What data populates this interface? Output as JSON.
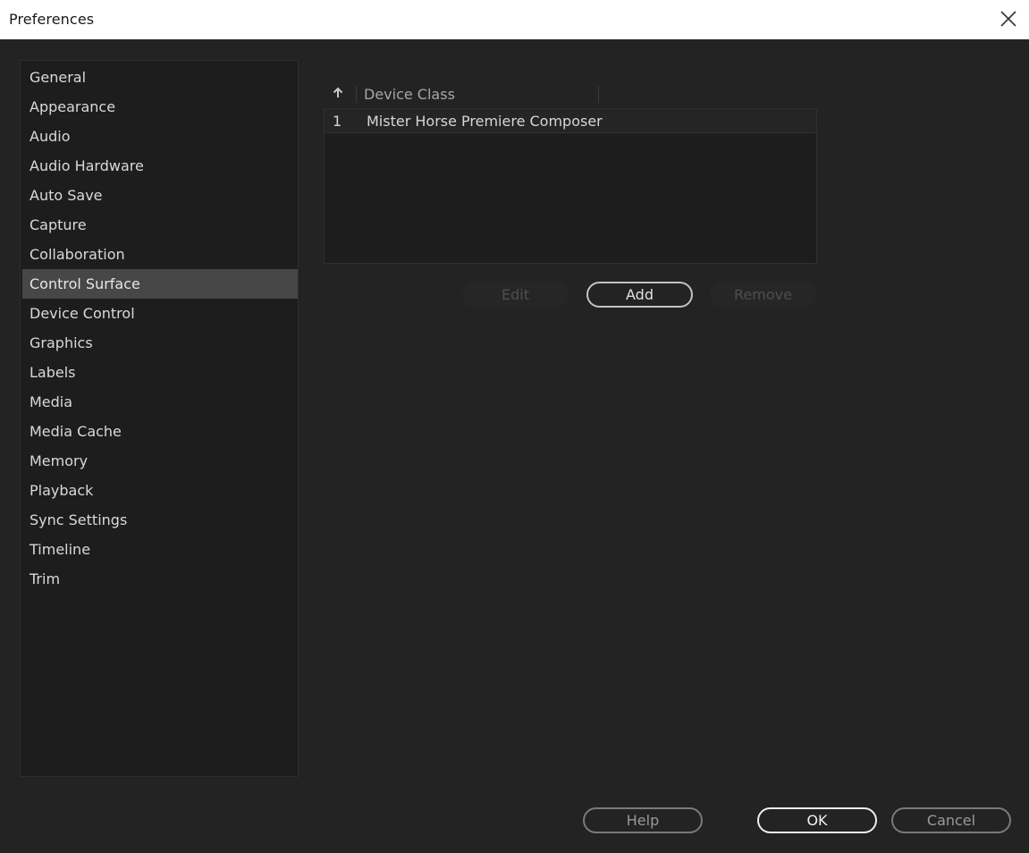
{
  "window": {
    "title": "Preferences",
    "close_icon": "close-icon"
  },
  "sidebar": {
    "selected": "Control Surface",
    "items": [
      {
        "label": "General"
      },
      {
        "label": "Appearance"
      },
      {
        "label": "Audio"
      },
      {
        "label": "Audio Hardware"
      },
      {
        "label": "Auto Save"
      },
      {
        "label": "Capture"
      },
      {
        "label": "Collaboration"
      },
      {
        "label": "Control Surface"
      },
      {
        "label": "Device Control"
      },
      {
        "label": "Graphics"
      },
      {
        "label": "Labels"
      },
      {
        "label": "Media"
      },
      {
        "label": "Media Cache"
      },
      {
        "label": "Memory"
      },
      {
        "label": "Playback"
      },
      {
        "label": "Sync Settings"
      },
      {
        "label": "Timeline"
      },
      {
        "label": "Trim"
      }
    ]
  },
  "device_table": {
    "sort_icon": "sort-up-arrow-icon",
    "columns": [
      "Device Class"
    ],
    "rows": [
      {
        "index": "1",
        "device_class": "Mister Horse Premiere Composer"
      }
    ]
  },
  "table_buttons": {
    "edit": "Edit",
    "add": "Add",
    "remove": "Remove"
  },
  "footer": {
    "help": "Help",
    "ok": "OK",
    "cancel": "Cancel"
  },
  "colors": {
    "background": "#232323",
    "panel": "#1d1d1d",
    "selected_item": "#474747",
    "titlebar": "#ffffff"
  }
}
